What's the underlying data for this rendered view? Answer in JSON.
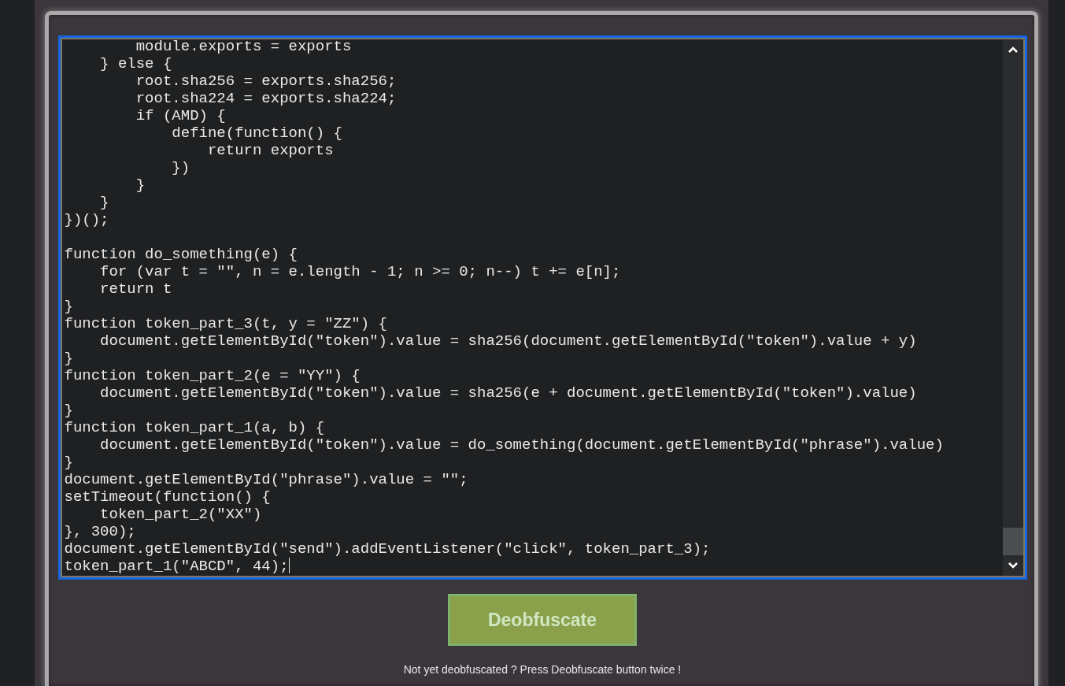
{
  "editor": {
    "code": "        module.exports = exports\n    } else {\n        root.sha256 = exports.sha256;\n        root.sha224 = exports.sha224;\n        if (AMD) {\n            define(function() {\n                return exports\n            })\n        }\n    }\n})();\n\nfunction do_something(e) {\n    for (var t = \"\", n = e.length - 1; n >= 0; n--) t += e[n];\n    return t\n}\nfunction token_part_3(t, y = \"ZZ\") {\n    document.getElementById(\"token\").value = sha256(document.getElementById(\"token\").value + y)\n}\nfunction token_part_2(e = \"YY\") {\n    document.getElementById(\"token\").value = sha256(e + document.getElementById(\"token\").value)\n}\nfunction token_part_1(a, b) {\n    document.getElementById(\"token\").value = do_something(document.getElementById(\"phrase\").value)\n}\ndocument.getElementById(\"phrase\").value = \"\";\nsetTimeout(function() {\n    token_part_2(\"XX\")\n}, 300);\ndocument.getElementById(\"send\").addEventListener(\"click\", token_part_3);\ntoken_part_1(\"ABCD\", 44);"
  },
  "button": {
    "label": "Deobfuscate"
  },
  "note": "Not yet deobfuscated ? Press Deobfuscate button twice !"
}
